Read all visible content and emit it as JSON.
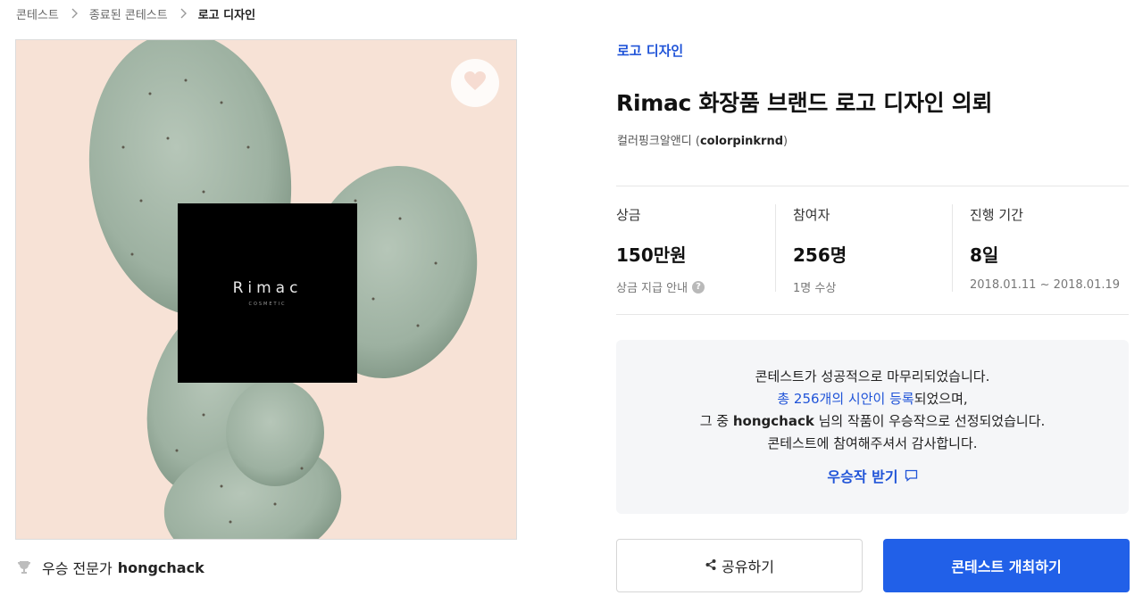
{
  "breadcrumb": {
    "items": [
      "콘테스트",
      "종료된 콘테스트",
      "로고 디자인"
    ]
  },
  "hero": {
    "logo_name": "Rimac",
    "logo_sub": "COSMETIC"
  },
  "winner": {
    "prefix": "우승 전문가",
    "name": "hongchack"
  },
  "contest": {
    "category": "로고 디자인",
    "title": "Rimac 화장품 브랜드 로고 디자인 의뢰",
    "host_name": "컬러핑크알앤디",
    "host_id_open": " (",
    "host_id": "colorpinkrnd",
    "host_id_close": ")"
  },
  "stats": [
    {
      "label": "상금",
      "value": "150만원",
      "sub": "상금 지급 안내"
    },
    {
      "label": "참여자",
      "value": "256명",
      "sub": "1명 수상"
    },
    {
      "label": "진행 기간",
      "value": "8일",
      "sub": "2018.01.11 ~ 2018.01.19"
    }
  ],
  "notice": {
    "line1": "콘테스트가 성공적으로 마무리되었습니다.",
    "line2_link": "총 256개의 시안이 등록",
    "line2_rest": "되었으며,",
    "line3_pre": "그 중 ",
    "line3_name": "hongchack",
    "line3_post": " 님의 작품이 우승작으로 선정되었습니다.",
    "line4": "콘테스트에 참여해주셔서 감사합니다.",
    "get_link": "우승작 받기"
  },
  "buttons": {
    "share": "공유하기",
    "host": "콘테스트 개최하기"
  },
  "colors": {
    "accent": "#2054d8",
    "primary_button": "#2160e8",
    "hero_bg": "#f7e2d6",
    "cactus": "#9fb3a2"
  },
  "icons": {
    "breadcrumb_separator": "chevron-right-icon",
    "favorite": "heart-icon",
    "winner": "trophy-icon",
    "info": "info-icon",
    "download": "comment-icon",
    "share": "share-icon"
  }
}
